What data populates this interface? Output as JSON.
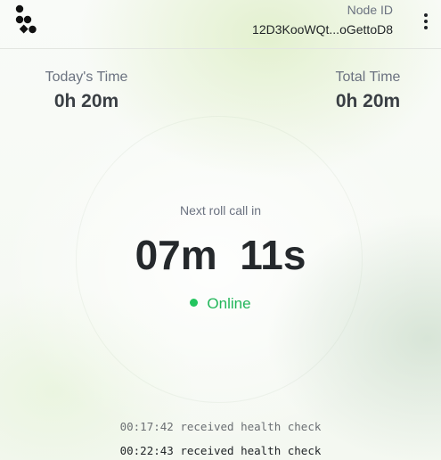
{
  "header": {
    "logo_icon": "dots-logo-icon",
    "node_id_label": "Node ID",
    "node_id_value": "12D3KooWQt...oGettoD8",
    "menu_icon": "vertical-dots-menu-icon"
  },
  "stats": {
    "today_label": "Today's Time",
    "today_value": "0h 20m",
    "total_label": "Total Time",
    "total_value": "0h 20m"
  },
  "timer": {
    "label": "Next roll call in",
    "value": "07m  11s"
  },
  "status": {
    "text": "Online",
    "color": "#22c55e"
  },
  "log": [
    {
      "text": "00:17:42 received health check"
    },
    {
      "text": "00:22:43 received health check"
    }
  ]
}
